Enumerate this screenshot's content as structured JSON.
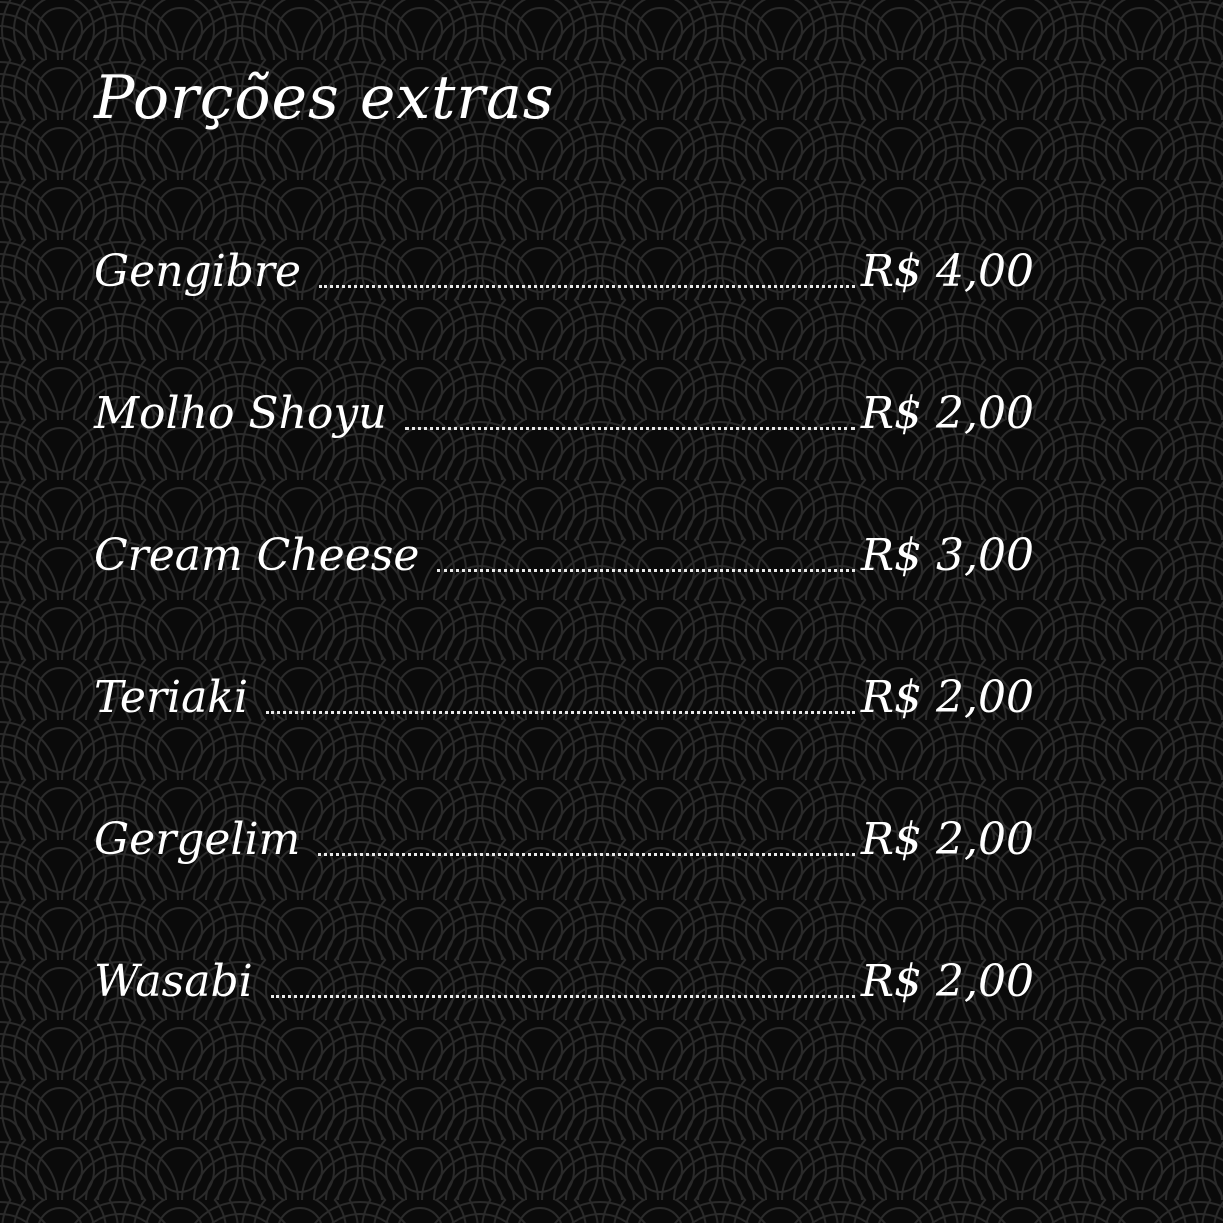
{
  "menu": {
    "title": "Porções extras",
    "items": [
      {
        "name": "Gengibre",
        "price": "R$ 4,00"
      },
      {
        "name": "Molho Shoyu",
        "price": "R$ 2,00"
      },
      {
        "name": "Cream Cheese",
        "price": "R$ 3,00"
      },
      {
        "name": "Teriaki",
        "price": "R$ 2,00"
      },
      {
        "name": "Gergelim",
        "price": "R$ 2,00"
      },
      {
        "name": "Wasabi",
        "price": "R$ 2,00"
      }
    ]
  },
  "colors": {
    "background": "#0a0a0a",
    "pattern": "#2a2a2a",
    "text": "#ffffff"
  },
  "icons": {
    "background": "seigaiha-wave-pattern"
  }
}
